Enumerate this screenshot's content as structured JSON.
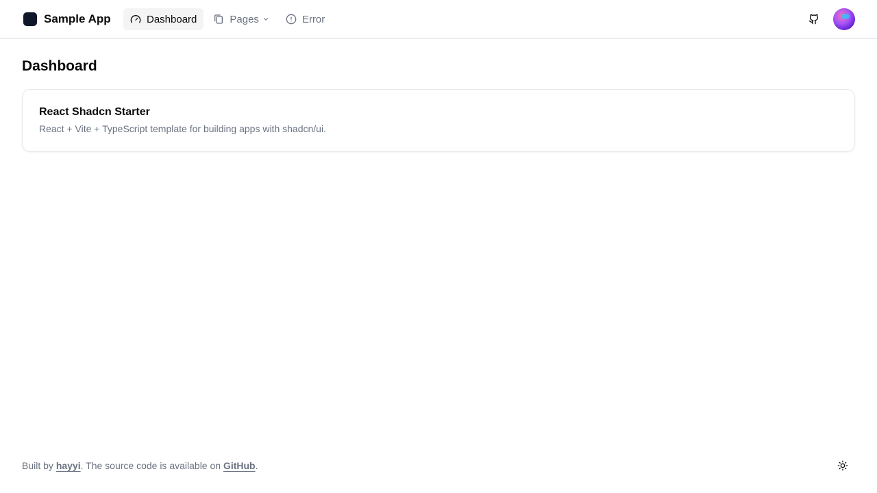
{
  "app": {
    "name": "Sample App"
  },
  "nav": {
    "items": [
      {
        "label": "Dashboard",
        "icon": "gauge-icon",
        "active": true
      },
      {
        "label": "Pages",
        "icon": "files-icon",
        "active": false,
        "has_dropdown": true
      },
      {
        "label": "Error",
        "icon": "alert-circle-icon",
        "active": false
      }
    ]
  },
  "header_actions": {
    "github_icon": "github-icon",
    "avatar": "user-avatar"
  },
  "main": {
    "title": "Dashboard",
    "card": {
      "title": "React Shadcn Starter",
      "description": "React + Vite + TypeScript template for building apps with shadcn/ui."
    }
  },
  "footer": {
    "prefix": "Built by ",
    "author_link": "hayyi",
    "middle": ". The source code is available on ",
    "source_link": "GitHub",
    "suffix": ".",
    "theme_icon": "sun-icon"
  },
  "colors": {
    "brand": "#0f172a",
    "muted_text": "#6b7280",
    "active_bg": "#f4f4f5",
    "border": "#e5e7eb"
  }
}
